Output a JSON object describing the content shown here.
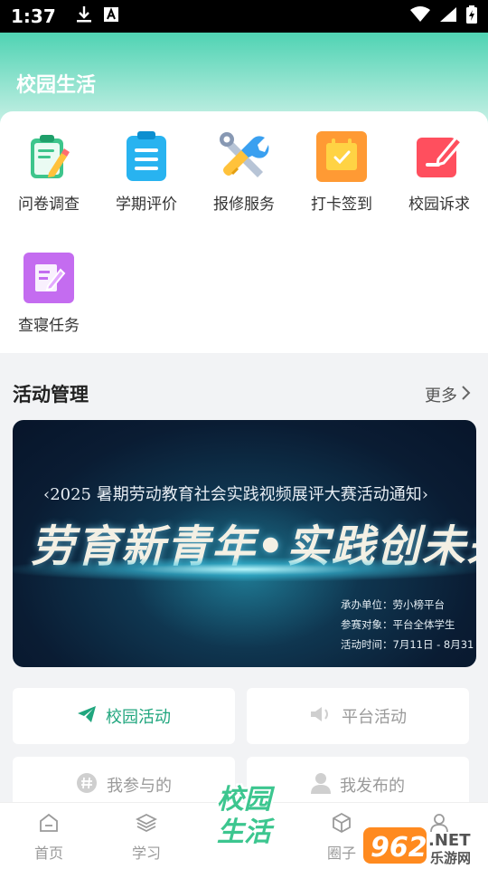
{
  "status_bar": {
    "time": "1:37"
  },
  "header": {
    "title": "校园生活"
  },
  "services": [
    {
      "label": "问卷调查",
      "icon": "clipboard-icon"
    },
    {
      "label": "学期评价",
      "icon": "document-list-icon"
    },
    {
      "label": "报修服务",
      "icon": "tools-icon"
    },
    {
      "label": "打卡签到",
      "icon": "calendar-check-icon"
    },
    {
      "label": "校园诉求",
      "icon": "edit-note-icon"
    },
    {
      "label": "查寝任务",
      "icon": "edit-page-icon"
    }
  ],
  "activity": {
    "title": "活动管理",
    "more": "更多",
    "banner": {
      "subtitle": "‹2025 暑期劳动教育社会实践视频展评大赛活动通知›",
      "headline": "劳育新青年•实践创未来",
      "info": [
        "承办单位：劳小榜平台",
        "参赛对象：平台全体学生",
        "活动时间：7月11日 - 8月31"
      ]
    },
    "tiles": [
      {
        "label": "校园活动",
        "icon": "paper-plane-icon",
        "active": true
      },
      {
        "label": "平台活动",
        "icon": "speaker-icon",
        "active": false
      },
      {
        "label": "我参与的",
        "icon": "hashtag-icon",
        "active": false
      },
      {
        "label": "我发布的",
        "icon": "user-icon",
        "active": false
      }
    ]
  },
  "tabbar": {
    "tabs": [
      {
        "label": "首页",
        "icon": "home-icon"
      },
      {
        "label": "学习",
        "icon": "layers-icon"
      },
      {
        "label": "圈子",
        "icon": "cube-icon"
      },
      {
        "label": "",
        "icon": "profile-icon"
      }
    ],
    "center_logo": {
      "line1": "校园",
      "line2": "生活"
    }
  },
  "watermark": {
    "text1": "962",
    "text2": ".NET",
    "text3": "乐游网"
  },
  "colors": {
    "accent": "#20a67e",
    "header_top": "#4fd3b3",
    "muted": "#9a9a9a"
  }
}
